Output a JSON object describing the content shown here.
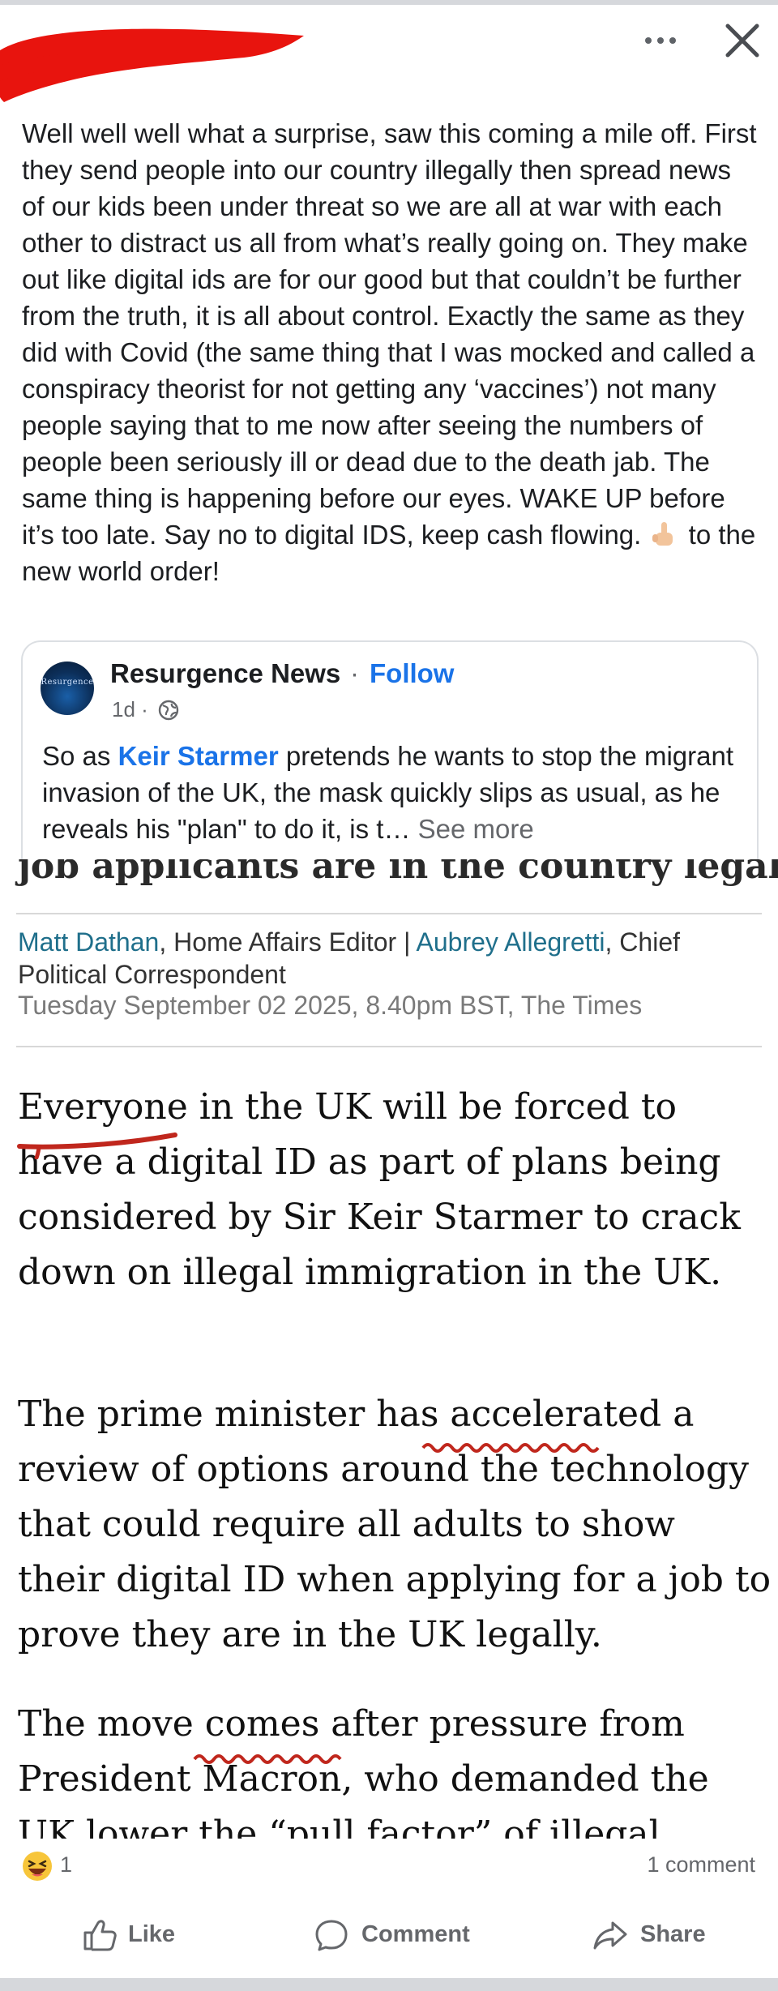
{
  "post": {
    "text_before_emoji": "Well well well what a surprise, saw this coming a mile off. First they send people into our country illegally then spread news of our kids been under threat so we are all at war with each other to distract us all from what’s really going on. They make out like digital ids are for our good but that couldn’t be further from the truth, it is all about control. Exactly the same as they did with Covid (the same thing that I was mocked and called a conspiracy theorist for not getting any ‘vaccines’) not many people saying that to me now after seeing the numbers of people been seriously ill or dead due to the death jab. The same thing is happening before our eyes. WAKE UP before it’s too late. Say no to digital IDS, keep cash flowing.",
    "text_after_emoji": "to the new world order!",
    "emoji_icon": "middle-finger-emoji"
  },
  "shared": {
    "page_name": "Resurgence News",
    "separator": "·",
    "follow_label": "Follow",
    "time": "1d ·",
    "avatar_text": "Resurgence",
    "text_before_link": "So as ",
    "link_text": "Keir Starmer",
    "text_after_link": " pretends he wants to stop the migrant invasion of the UK, the mask quickly slips as usual, as he reveals his \"plan\" to do it, is t…",
    "see_more": "See more"
  },
  "article": {
    "headline_fragment": "job applicants are in the country legally",
    "author1": "Matt Dathan",
    "author1_role": ", Home Affairs Editor | ",
    "author2": "Aubrey Allegretti",
    "author2_role": ", Chief Political Correspondent",
    "dateline": "Tuesday September 02 2025, 8.40pm BST, The Times",
    "paragraphs": [
      "Everyone in the UK will be forced to have a digital ID as part of plans being considered by Sir Keir Starmer to crack down on illegal immigration in the UK.",
      "The prime minister has accelerated a review of options around the technology that could require all adults to show their digital ID when applying for a job to prove they are in the UK legally.",
      "The move comes after pressure from President Macron, who demanded the UK lower the “pull factor” of illegal working as part of a deal in July that led to the one"
    ],
    "annotation_color": "#c0271d"
  },
  "footer": {
    "reaction_icon": "laughing-emoji",
    "reaction_count": "1",
    "comment_count": "1 comment",
    "like_label": "Like",
    "comment_label": "Comment",
    "share_label": "Share"
  },
  "colors": {
    "link_blue": "#1a73e8",
    "meta_gray": "#65676b",
    "redaction_red": "#e8140e"
  }
}
